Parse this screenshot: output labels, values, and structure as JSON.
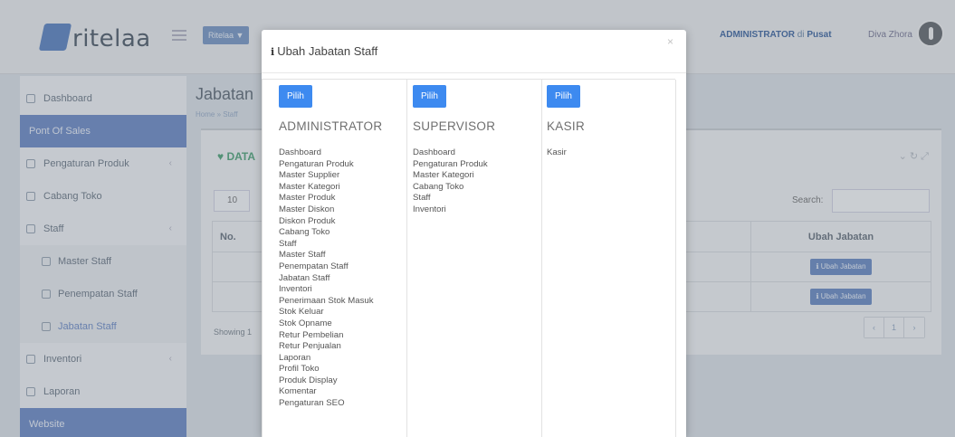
{
  "header": {
    "logo_text": "ritelaa",
    "store_button": "Ritelaa ▼",
    "admin_role": "ADMINISTRATOR",
    "admin_di": "di",
    "admin_location": "Pusat",
    "user_name": "Diva Zhora"
  },
  "sidebar": {
    "items": [
      {
        "label": "Dashboard",
        "icon": "home-icon"
      },
      {
        "label": "Pont Of Sales",
        "section": true
      },
      {
        "label": "Pengaturan Produk",
        "icon": "grid-icon"
      },
      {
        "label": "Cabang Toko",
        "icon": "map-marker-icon"
      },
      {
        "label": "Staff",
        "icon": "users-icon",
        "active": true
      },
      {
        "label": "Master Staff",
        "icon": "users-icon"
      },
      {
        "label": "Penempatan Staff",
        "icon": "map-marker-icon"
      },
      {
        "label": "Jabatan Staff",
        "icon": "sitemap-icon"
      },
      {
        "label": "Inventori",
        "icon": "boxes-icon"
      },
      {
        "label": "Laporan",
        "icon": "file-icon"
      },
      {
        "label": "Website",
        "section": true
      }
    ]
  },
  "content": {
    "page_title": "Jabatan",
    "breadcrumb": "Home » Staff",
    "box_title": "♥ DATA",
    "length_value": "10",
    "search_label": "Search:",
    "table": {
      "col_no": "No.",
      "col_ubah": "Ubah Jabatan",
      "ubah_label": "Ubah Jabatan"
    },
    "showing": "Showing 1",
    "pager": [
      "‹",
      "1",
      "›"
    ]
  },
  "modal": {
    "title": "Ubah Jabatan Staff",
    "close": "×",
    "roles": [
      {
        "button": "Pilih",
        "name": "ADMINISTRATOR",
        "permissions": [
          "Dashboard",
          "Pengaturan Produk",
          "Master Supplier",
          "Master Kategori",
          "Master Produk",
          "Master Diskon",
          "Diskon Produk",
          "Cabang Toko",
          "Staff",
          "Master Staff",
          "Penempatan Staff",
          "Jabatan Staff",
          "Inventori",
          "Penerimaan Stok Masuk",
          "Stok Keluar",
          "Stok Opname",
          "Retur Pembelian",
          "Retur Penjualan",
          "Laporan",
          "Profil Toko",
          "Produk Display",
          "Komentar",
          "Pengaturan SEO"
        ]
      },
      {
        "button": "Pilih",
        "name": "SUPERVISOR",
        "permissions": [
          "Dashboard",
          "Pengaturan Produk",
          "Master Kategori",
          "Cabang Toko",
          "Staff",
          "Inventori"
        ]
      },
      {
        "button": "Pilih",
        "name": "KASIR",
        "permissions": [
          "Kasir"
        ]
      }
    ]
  }
}
